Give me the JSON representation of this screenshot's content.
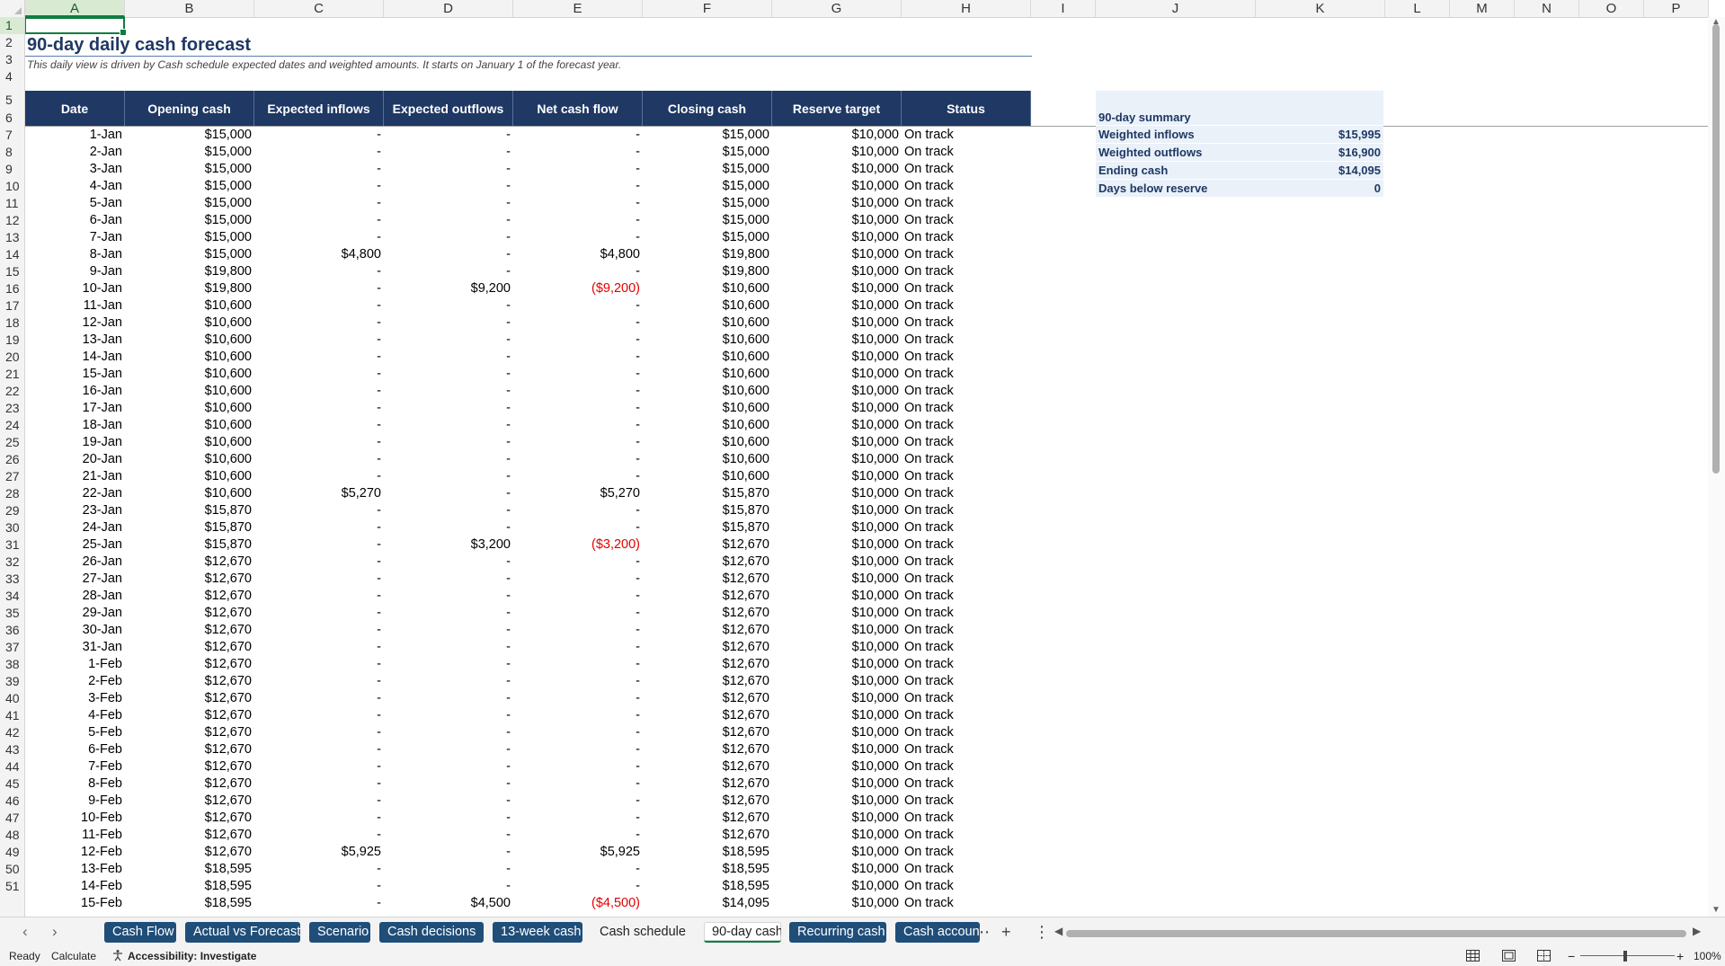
{
  "column_headers": [
    "A",
    "B",
    "C",
    "D",
    "E",
    "F",
    "G",
    "H",
    "I",
    "J",
    "K",
    "L",
    "M",
    "N",
    "O",
    "P"
  ],
  "row_numbers": [
    "1",
    "2",
    "3",
    "4",
    "5",
    "6",
    "7",
    "8",
    "9",
    "10",
    "11",
    "12",
    "13",
    "14",
    "15",
    "16",
    "17",
    "18",
    "19",
    "20",
    "21",
    "22",
    "23",
    "24",
    "25",
    "26",
    "27",
    "28",
    "29",
    "30",
    "31",
    "32",
    "33",
    "34",
    "35",
    "36",
    "37",
    "38",
    "39",
    "40",
    "41",
    "42",
    "43",
    "44",
    "45",
    "46",
    "47",
    "48",
    "49",
    "50",
    "51"
  ],
  "sheet": {
    "title": "90-day daily cash forecast",
    "subtitle": "This daily view is driven by Cash schedule expected dates and weighted amounts. It starts on January 1 of the forecast year."
  },
  "table": {
    "headers": [
      "Date",
      "Opening cash",
      "Expected inflows",
      "Expected outflows",
      "Net cash flow",
      "Closing cash",
      "Reserve target",
      "Status"
    ],
    "rows": [
      [
        "1-Jan",
        "$15,000",
        "-",
        "-",
        "-",
        "$15,000",
        "$10,000",
        "On track"
      ],
      [
        "2-Jan",
        "$15,000",
        "-",
        "-",
        "-",
        "$15,000",
        "$10,000",
        "On track"
      ],
      [
        "3-Jan",
        "$15,000",
        "-",
        "-",
        "-",
        "$15,000",
        "$10,000",
        "On track"
      ],
      [
        "4-Jan",
        "$15,000",
        "-",
        "-",
        "-",
        "$15,000",
        "$10,000",
        "On track"
      ],
      [
        "5-Jan",
        "$15,000",
        "-",
        "-",
        "-",
        "$15,000",
        "$10,000",
        "On track"
      ],
      [
        "6-Jan",
        "$15,000",
        "-",
        "-",
        "-",
        "$15,000",
        "$10,000",
        "On track"
      ],
      [
        "7-Jan",
        "$15,000",
        "-",
        "-",
        "-",
        "$15,000",
        "$10,000",
        "On track"
      ],
      [
        "8-Jan",
        "$15,000",
        "$4,800",
        "-",
        "$4,800",
        "$19,800",
        "$10,000",
        "On track"
      ],
      [
        "9-Jan",
        "$19,800",
        "-",
        "-",
        "-",
        "$19,800",
        "$10,000",
        "On track"
      ],
      [
        "10-Jan",
        "$19,800",
        "-",
        "$9,200",
        "($9,200)",
        "$10,600",
        "$10,000",
        "On track"
      ],
      [
        "11-Jan",
        "$10,600",
        "-",
        "-",
        "-",
        "$10,600",
        "$10,000",
        "On track"
      ],
      [
        "12-Jan",
        "$10,600",
        "-",
        "-",
        "-",
        "$10,600",
        "$10,000",
        "On track"
      ],
      [
        "13-Jan",
        "$10,600",
        "-",
        "-",
        "-",
        "$10,600",
        "$10,000",
        "On track"
      ],
      [
        "14-Jan",
        "$10,600",
        "-",
        "-",
        "-",
        "$10,600",
        "$10,000",
        "On track"
      ],
      [
        "15-Jan",
        "$10,600",
        "-",
        "-",
        "-",
        "$10,600",
        "$10,000",
        "On track"
      ],
      [
        "16-Jan",
        "$10,600",
        "-",
        "-",
        "-",
        "$10,600",
        "$10,000",
        "On track"
      ],
      [
        "17-Jan",
        "$10,600",
        "-",
        "-",
        "-",
        "$10,600",
        "$10,000",
        "On track"
      ],
      [
        "18-Jan",
        "$10,600",
        "-",
        "-",
        "-",
        "$10,600",
        "$10,000",
        "On track"
      ],
      [
        "19-Jan",
        "$10,600",
        "-",
        "-",
        "-",
        "$10,600",
        "$10,000",
        "On track"
      ],
      [
        "20-Jan",
        "$10,600",
        "-",
        "-",
        "-",
        "$10,600",
        "$10,000",
        "On track"
      ],
      [
        "21-Jan",
        "$10,600",
        "-",
        "-",
        "-",
        "$10,600",
        "$10,000",
        "On track"
      ],
      [
        "22-Jan",
        "$10,600",
        "$5,270",
        "-",
        "$5,270",
        "$15,870",
        "$10,000",
        "On track"
      ],
      [
        "23-Jan",
        "$15,870",
        "-",
        "-",
        "-",
        "$15,870",
        "$10,000",
        "On track"
      ],
      [
        "24-Jan",
        "$15,870",
        "-",
        "-",
        "-",
        "$15,870",
        "$10,000",
        "On track"
      ],
      [
        "25-Jan",
        "$15,870",
        "-",
        "$3,200",
        "($3,200)",
        "$12,670",
        "$10,000",
        "On track"
      ],
      [
        "26-Jan",
        "$12,670",
        "-",
        "-",
        "-",
        "$12,670",
        "$10,000",
        "On track"
      ],
      [
        "27-Jan",
        "$12,670",
        "-",
        "-",
        "-",
        "$12,670",
        "$10,000",
        "On track"
      ],
      [
        "28-Jan",
        "$12,670",
        "-",
        "-",
        "-",
        "$12,670",
        "$10,000",
        "On track"
      ],
      [
        "29-Jan",
        "$12,670",
        "-",
        "-",
        "-",
        "$12,670",
        "$10,000",
        "On track"
      ],
      [
        "30-Jan",
        "$12,670",
        "-",
        "-",
        "-",
        "$12,670",
        "$10,000",
        "On track"
      ],
      [
        "31-Jan",
        "$12,670",
        "-",
        "-",
        "-",
        "$12,670",
        "$10,000",
        "On track"
      ],
      [
        "1-Feb",
        "$12,670",
        "-",
        "-",
        "-",
        "$12,670",
        "$10,000",
        "On track"
      ],
      [
        "2-Feb",
        "$12,670",
        "-",
        "-",
        "-",
        "$12,670",
        "$10,000",
        "On track"
      ],
      [
        "3-Feb",
        "$12,670",
        "-",
        "-",
        "-",
        "$12,670",
        "$10,000",
        "On track"
      ],
      [
        "4-Feb",
        "$12,670",
        "-",
        "-",
        "-",
        "$12,670",
        "$10,000",
        "On track"
      ],
      [
        "5-Feb",
        "$12,670",
        "-",
        "-",
        "-",
        "$12,670",
        "$10,000",
        "On track"
      ],
      [
        "6-Feb",
        "$12,670",
        "-",
        "-",
        "-",
        "$12,670",
        "$10,000",
        "On track"
      ],
      [
        "7-Feb",
        "$12,670",
        "-",
        "-",
        "-",
        "$12,670",
        "$10,000",
        "On track"
      ],
      [
        "8-Feb",
        "$12,670",
        "-",
        "-",
        "-",
        "$12,670",
        "$10,000",
        "On track"
      ],
      [
        "9-Feb",
        "$12,670",
        "-",
        "-",
        "-",
        "$12,670",
        "$10,000",
        "On track"
      ],
      [
        "10-Feb",
        "$12,670",
        "-",
        "-",
        "-",
        "$12,670",
        "$10,000",
        "On track"
      ],
      [
        "11-Feb",
        "$12,670",
        "-",
        "-",
        "-",
        "$12,670",
        "$10,000",
        "On track"
      ],
      [
        "12-Feb",
        "$12,670",
        "$5,925",
        "-",
        "$5,925",
        "$18,595",
        "$10,000",
        "On track"
      ],
      [
        "13-Feb",
        "$18,595",
        "-",
        "-",
        "-",
        "$18,595",
        "$10,000",
        "On track"
      ],
      [
        "14-Feb",
        "$18,595",
        "-",
        "-",
        "-",
        "$18,595",
        "$10,000",
        "On track"
      ],
      [
        "15-Feb",
        "$18,595",
        "-",
        "$4,500",
        "($4,500)",
        "$14,095",
        "$10,000",
        "On track"
      ]
    ]
  },
  "summary": {
    "title": "90-day summary",
    "rows": [
      {
        "label": "Weighted inflows",
        "value": "$15,995"
      },
      {
        "label": "Weighted outflows",
        "value": "$16,900"
      },
      {
        "label": "Ending cash",
        "value": "$14,095"
      },
      {
        "label": "Days below reserve",
        "value": "0"
      }
    ]
  },
  "tabs": [
    {
      "label": "Cash Flow",
      "style": "colored"
    },
    {
      "label": "Actual vs Forecast",
      "style": "colored"
    },
    {
      "label": "Scenario",
      "style": "colored"
    },
    {
      "label": "Cash decisions",
      "style": "colored"
    },
    {
      "label": "13-week cash",
      "style": "colored"
    },
    {
      "label": "Cash schedule",
      "style": "plain"
    },
    {
      "label": "90-day cash",
      "style": "active"
    },
    {
      "label": "Recurring cash",
      "style": "colored"
    },
    {
      "label": "Cash account",
      "style": "colored"
    }
  ],
  "tab_controls": {
    "more": "⋯",
    "add": "+",
    "options": "⋮"
  },
  "statusbar": {
    "ready": "Ready",
    "calculate": "Calculate",
    "accessibility": "Accessibility: Investigate",
    "zoom": "100%",
    "minus": "−",
    "plus": "+"
  },
  "colors": {
    "header_bg": "#1f3864",
    "negative": "#e00000",
    "summary_bg": "#eaf1f8",
    "accent": "#107c41"
  },
  "icons": {
    "accessibility": "accessibility-icon",
    "normal_view": "grid-view-icon",
    "page_layout": "page-layout-icon",
    "page_break": "page-break-icon"
  }
}
